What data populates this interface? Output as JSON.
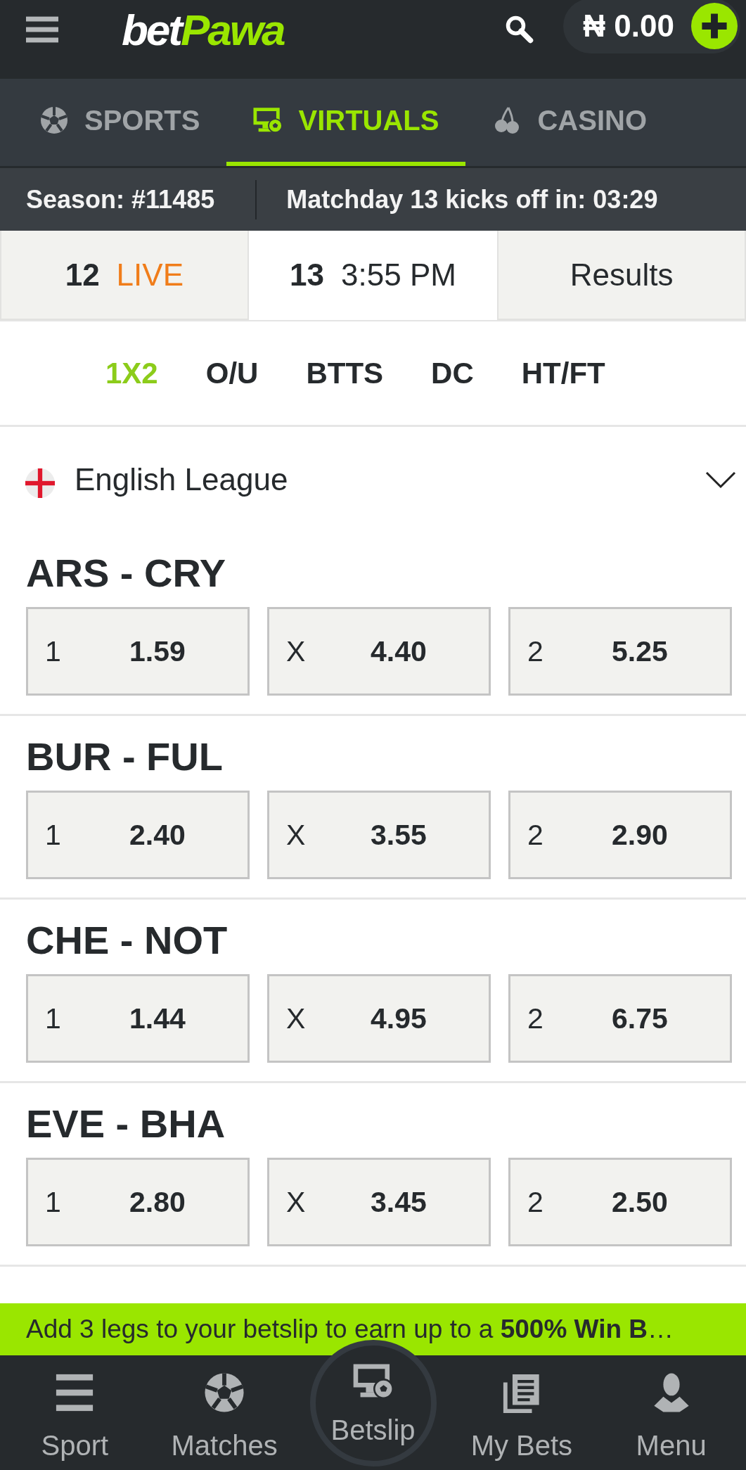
{
  "header": {
    "logo": {
      "text": "bet",
      "accent": "Pawa"
    },
    "balance": "₦ 0.00"
  },
  "nav_tabs": [
    {
      "label": "SPORTS",
      "selected": false
    },
    {
      "label": "VIRTUALS",
      "selected": true
    },
    {
      "label": "CASINO",
      "selected": false
    }
  ],
  "season_bar": {
    "season": "Season: #11485",
    "countdown": "Matchday 13 kicks off in: 03:29"
  },
  "day_tabs": [
    {
      "kind": "live",
      "number": "12",
      "label": "LIVE",
      "selected": false
    },
    {
      "kind": "time",
      "number": "13",
      "label": "3:55 PM",
      "selected": true
    },
    {
      "kind": "results",
      "label": "Results",
      "selected": false
    }
  ],
  "market_tabs": [
    {
      "label": "1X2",
      "selected": true
    },
    {
      "label": "O/U",
      "selected": false
    },
    {
      "label": "BTTS",
      "selected": false
    },
    {
      "label": "DC",
      "selected": false
    },
    {
      "label": "HT/FT",
      "selected": false
    }
  ],
  "league": {
    "name": "English League"
  },
  "matches": [
    {
      "teams": "ARS - CRY",
      "odds": [
        {
          "outcome": "1",
          "price": "1.59"
        },
        {
          "outcome": "X",
          "price": "4.40"
        },
        {
          "outcome": "2",
          "price": "5.25"
        }
      ]
    },
    {
      "teams": "BUR - FUL",
      "odds": [
        {
          "outcome": "1",
          "price": "2.40"
        },
        {
          "outcome": "X",
          "price": "3.55"
        },
        {
          "outcome": "2",
          "price": "2.90"
        }
      ]
    },
    {
      "teams": "CHE - NOT",
      "odds": [
        {
          "outcome": "1",
          "price": "1.44"
        },
        {
          "outcome": "X",
          "price": "4.95"
        },
        {
          "outcome": "2",
          "price": "6.75"
        }
      ]
    },
    {
      "teams": "EVE - BHA",
      "odds": [
        {
          "outcome": "1",
          "price": "2.80"
        },
        {
          "outcome": "X",
          "price": "3.45"
        },
        {
          "outcome": "2",
          "price": "2.50"
        }
      ]
    }
  ],
  "promo_banner": {
    "text": "Add 3 legs to your betslip to earn up to a **500% Win B**…"
  },
  "bottom_nav": [
    {
      "label": "Sport",
      "selected": false
    },
    {
      "label": "Matches",
      "selected": false
    },
    {
      "label": "Betslip",
      "selected": false
    },
    {
      "label": "My Bets",
      "selected": false
    },
    {
      "label": "Menu",
      "selected": false
    }
  ]
}
